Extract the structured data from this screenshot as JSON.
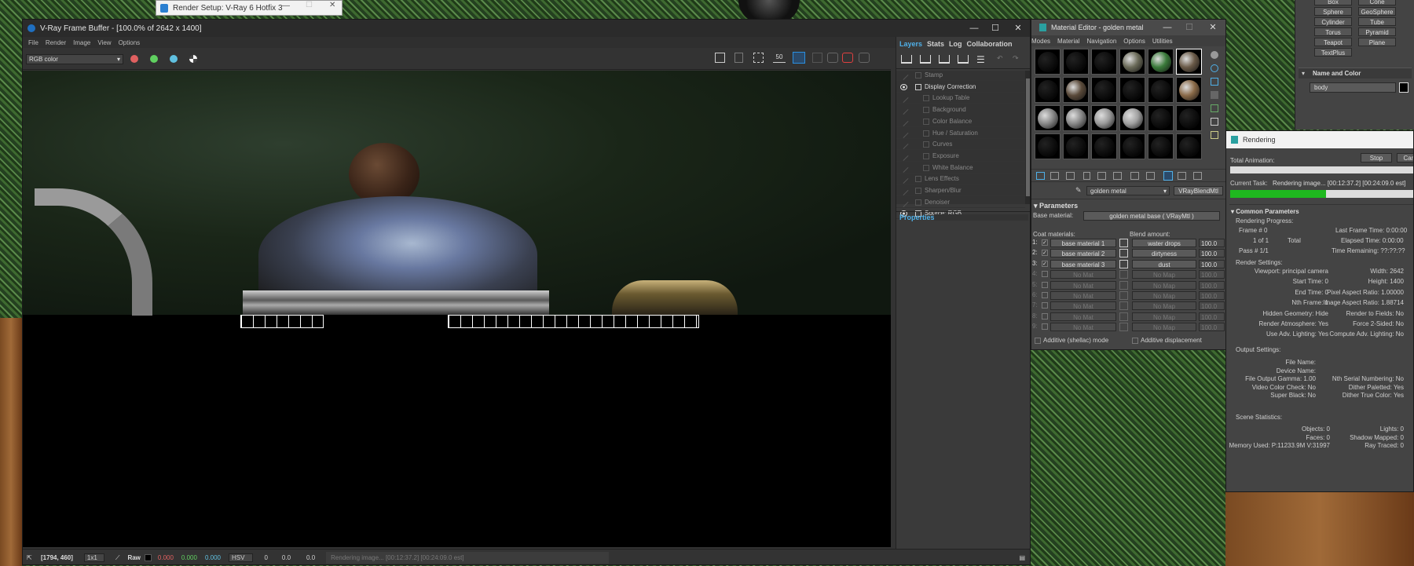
{
  "render_setup": {
    "title": "Render Setup: V-Ray 6 Hotfix 3"
  },
  "vfb": {
    "title": "V-Ray Frame Buffer - [100.0% of 2642 x 1400]",
    "menu": [
      "File",
      "Render",
      "Image",
      "View",
      "Options"
    ],
    "channel": "RGB color",
    "tabs": [
      "Layers",
      "Stats",
      "Log",
      "Collaboration"
    ],
    "layers": [
      {
        "label": "Stamp",
        "visible": false,
        "indent": 0
      },
      {
        "label": "Display Correction",
        "visible": true,
        "indent": 0
      },
      {
        "label": "Lookup Table",
        "visible": false,
        "indent": 1
      },
      {
        "label": "Background",
        "visible": false,
        "indent": 1
      },
      {
        "label": "Color Balance",
        "visible": false,
        "indent": 1
      },
      {
        "label": "Hue / Saturation",
        "visible": false,
        "indent": 1
      },
      {
        "label": "Curves",
        "visible": false,
        "indent": 1
      },
      {
        "label": "Exposure",
        "visible": false,
        "indent": 1
      },
      {
        "label": "White Balance",
        "visible": false,
        "indent": 1
      },
      {
        "label": "Lens Effects",
        "visible": false,
        "indent": 0
      },
      {
        "label": "Sharpen/Blur",
        "visible": false,
        "indent": 0
      },
      {
        "label": "Denoiser",
        "visible": false,
        "indent": 0
      },
      {
        "label": "Source: RGB",
        "visible": true,
        "indent": 0
      }
    ],
    "properties_label": "Properties",
    "status": {
      "coords": "[1794, 460]",
      "zoom": "1x1",
      "mode": "Raw",
      "r": "0.000",
      "g": "0.000",
      "b": "0.000",
      "space": "HSV",
      "h": "0",
      "s": "0.0",
      "v": "0.0",
      "progress": "Rendering image... [00:12:37.2] [00:24:09.0 est]"
    }
  },
  "material_editor": {
    "title": "Material Editor - golden metal",
    "menu": [
      "Modes",
      "Material",
      "Navigation",
      "Options",
      "Utilities"
    ],
    "material_name": "golden metal",
    "material_type": "VRayBlendMtl",
    "rollout": "Parameters",
    "base_material_label": "Base material:",
    "base_material": "golden metal base ( VRayMtl )",
    "coat_label": "Coat materials:",
    "blend_label": "Blend amount:",
    "coats": [
      {
        "n": "1:",
        "mat": "base material 1",
        "map": "water drops",
        "amt": "100.0",
        "on": true
      },
      {
        "n": "2:",
        "mat": "base material 2",
        "map": "dirtyness",
        "amt": "100.0",
        "on": true
      },
      {
        "n": "3:",
        "mat": "base material 3",
        "map": "dust",
        "amt": "100.0",
        "on": true
      },
      {
        "n": "4:",
        "mat": "No Mat",
        "map": "No Map",
        "amt": "100.0",
        "on": false
      },
      {
        "n": "5:",
        "mat": "No Mat",
        "map": "No Map",
        "amt": "100.0",
        "on": false
      },
      {
        "n": "6:",
        "mat": "No Mat",
        "map": "No Map",
        "amt": "100.0",
        "on": false
      },
      {
        "n": "7:",
        "mat": "No Mat",
        "map": "No Map",
        "amt": "100.0",
        "on": false
      },
      {
        "n": "8:",
        "mat": "No Mat",
        "map": "No Map",
        "amt": "100.0",
        "on": false
      },
      {
        "n": "9:",
        "mat": "No Mat",
        "map": "No Map",
        "amt": "100.0",
        "on": false
      }
    ],
    "additive_shellac": "Additive (shellac) mode",
    "additive_disp": "Additive displacement"
  },
  "create_panel": {
    "objects": [
      "Box",
      "Cone",
      "Sphere",
      "GeoSphere",
      "Cylinder",
      "Tube",
      "Torus",
      "Pyramid",
      "Teapot",
      "Plane",
      "TextPlus"
    ],
    "name_color_label": "Name and Color",
    "object_name": "body",
    "color": "#000000"
  },
  "rendering": {
    "title": "Rendering",
    "stop": "Stop",
    "cancel": "Cance",
    "total_anim": "Total Animation:",
    "current_task": "Current Task:",
    "task_text": "Rendering image... [00:12:37.2] [00:24:09.0 est]",
    "task_progress": 0.52,
    "common": "Common Parameters",
    "progress_hdr": "Rendering Progress:",
    "frame": "Frame # 0",
    "last_frame": "Last Frame Time: 0:00:00",
    "of": "1 of 1",
    "total": "Total",
    "elapsed": "Elapsed Time: 0:00:00",
    "pass": "Pass # 1/1",
    "remaining": "Time Remaining: ??:??:??",
    "settings_hdr": "Render Settings:",
    "settings": [
      [
        "Viewport: principal camera",
        "Width: 2642"
      ],
      [
        "Start Time: 0",
        "Height: 1400"
      ],
      [
        "End Time: 0",
        "Pixel Aspect Ratio: 1.00000"
      ],
      [
        "Nth Frame: 1",
        "Image Aspect Ratio: 1.88714"
      ],
      [
        "Hidden Geometry: Hide",
        "Render to Fields: No"
      ],
      [
        "Render Atmosphere: Yes",
        "Force 2-Sided: No"
      ],
      [
        "Use Adv. Lighting: Yes",
        "Compute Adv. Lighting: No"
      ]
    ],
    "output_hdr": "Output Settings:",
    "output": [
      [
        "File Name:",
        ""
      ],
      [
        "Device Name:",
        ""
      ],
      [
        "File Output Gamma: 1.00",
        "Nth Serial Numbering: No"
      ],
      [
        "Video Color Check: No",
        "Dither Paletted: Yes"
      ],
      [
        "Super Black: No",
        "Dither True Color: Yes"
      ]
    ],
    "stats_hdr": "Scene Statistics:",
    "stats": [
      [
        "Objects: 0",
        "Lights: 0"
      ],
      [
        "Faces: 0",
        "Shadow Mapped: 0"
      ],
      [
        "Memory Used: P:11233.9M V:31997",
        "Ray Traced: 0"
      ]
    ]
  }
}
